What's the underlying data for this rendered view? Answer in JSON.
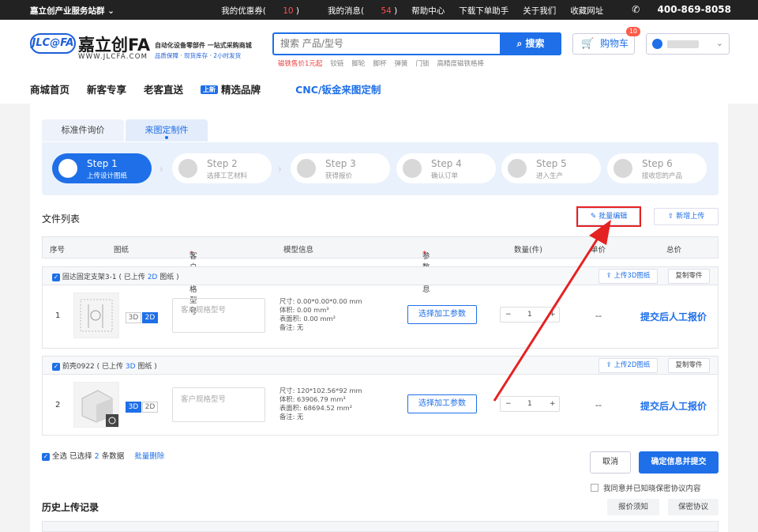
{
  "topbar": {
    "community": "嘉立创产业服务站群",
    "coupons_label": "我的优惠券",
    "coupons_count": "10",
    "messages_label": "我的消息",
    "messages_count": "54",
    "help": "帮助中心",
    "app": "下载下单助手",
    "about": "关于我们",
    "favorites": "收藏网址",
    "phone": "400-869-8058"
  },
  "header": {
    "logo": "JLC@FA",
    "brand": "嘉立创FA",
    "brand_sub": "WWW.JLCFA.COM",
    "slogan_main": "自动化设备零部件 一站式采购商城",
    "slogan_sub": "品质保障 · 现货库存 · 2小时发货",
    "search_placeholder": "搜索 产品/型号",
    "search_button": "搜索",
    "hot_words": [
      "磁铁售价1元起",
      "铰链",
      "脚轮",
      "脚杯",
      "弹簧",
      "门锁",
      "高精度磁铁格棒"
    ],
    "cart_label": "购物车",
    "cart_badge": "10"
  },
  "nav": {
    "items": [
      "商城首页",
      "新客专享",
      "老客直送"
    ],
    "new_tag": "上新",
    "featured": "精选品牌",
    "cnc": "CNC/钣金来图定制"
  },
  "main": {
    "tabs": [
      "标准件询价",
      "来图定制件"
    ],
    "steps": [
      {
        "title": "Step 1",
        "desc": "上传设计图纸"
      },
      {
        "title": "Step 2",
        "desc": "选择工艺材料"
      },
      {
        "title": "Step 3",
        "desc": "获得报价"
      },
      {
        "title": "Step 4",
        "desc": "确认订单"
      },
      {
        "title": "Step 5",
        "desc": "进入生产"
      },
      {
        "title": "Step 6",
        "desc": "接收您的产品"
      }
    ],
    "file_list_title": "文件列表",
    "batch_edit": "批量编辑",
    "add_upload": "新增上传",
    "columns": [
      "序号",
      "图纸",
      "客户规格型号",
      "模型信息",
      "参数信息",
      "数量(件)",
      "单价",
      "总价"
    ],
    "items": [
      {
        "name": "固达固定支架3-1",
        "status_pre": "( 已上传 ",
        "status_hi": "2D",
        "status_post": " 图纸 )",
        "upload_btn": "上传3D图纸",
        "copy_btn": "复制零件",
        "index": "1",
        "toggle_3d": "3D",
        "toggle_2d": "2D",
        "spec_placeholder": "客户规格型号",
        "geo": [
          "尺寸: 0.00*0.00*0.00 mm",
          "体积: 0.00 mm³",
          "表面积: 0.00 mm²",
          "备注: 无"
        ],
        "param_btn": "选择加工参数",
        "qty": "1",
        "price": "--",
        "total": "提交后人工报价"
      },
      {
        "name": "前壳0922",
        "status_pre": "( 已上传 ",
        "status_hi": "3D",
        "status_post": " 图纸 )",
        "upload_btn": "上传2D图纸",
        "copy_btn": "复制零件",
        "index": "2",
        "toggle_3d": "3D",
        "toggle_2d": "2D",
        "spec_placeholder": "客户规格型号",
        "geo": [
          "尺寸: 120*102.56*92 mm",
          "体积: 63906.79 mm³",
          "表面积: 68694.52 mm²",
          "备注: 无"
        ],
        "param_btn": "选择加工参数",
        "qty": "1",
        "price": "--",
        "total": "提交后人工报价"
      }
    ],
    "select_all": "全选",
    "selected_pre": "已选择",
    "selected_count": "2",
    "selected_post": "条数据",
    "batch_delete": "批量删除",
    "cancel": "取消",
    "confirm_submit": "确定信息并提交",
    "agree_text": "我同意并已知晓保密协议内容",
    "history_title": "历史上传记录",
    "quote_notice": "报价须知",
    "nda": "保密协议"
  },
  "colors": {
    "primary": "#1e6fe8",
    "highlight": "#e52222",
    "topbar": "#222222"
  }
}
